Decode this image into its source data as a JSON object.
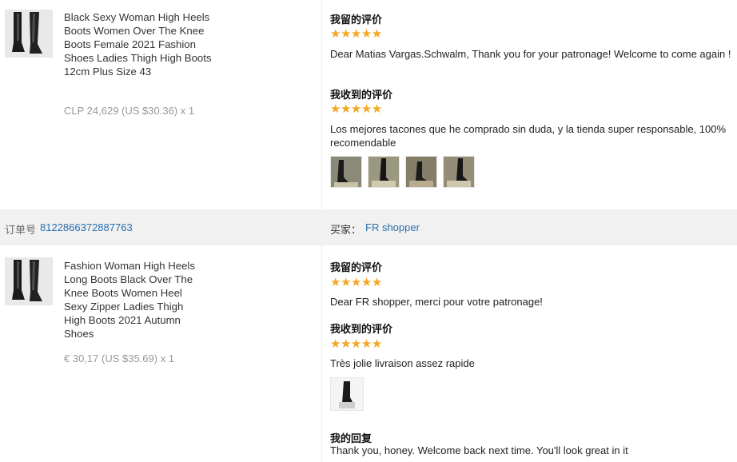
{
  "orders": [
    {
      "product": {
        "title": "Black Sexy Woman High Heels Boots Women Over The Knee Boots Female 2021 Fashion Shoes Ladies Thigh High Boots 12cm Plus Size 43",
        "price": "CLP 24,629 (US $30.36) x 1"
      },
      "my_review": {
        "label": "我留的评价",
        "stars": "★★★★★",
        "rating": 5,
        "text": "Dear Matias Vargas.Schwalm, Thank you for your patronage! Welcome to come again !"
      },
      "received_review": {
        "label": "我收到的评价",
        "stars": "★★★★★",
        "rating": 5,
        "text": "Los mejores tacones que he comprado sin duda, y la tienda super responsable, 100% recomendable",
        "photo_count": 4
      }
    },
    {
      "order_no_label": "订单号",
      "order_no": "8122866372887763",
      "buyer_label": "买家：",
      "buyer": "FR shopper",
      "product": {
        "title": "Fashion Woman High Heels Long Boots Black Over The Knee Boots Women Heel Sexy Zipper Ladies Thigh High Boots 2021 Autumn Shoes",
        "price": "€ 30,17 (US $35.69) x 1"
      },
      "my_review": {
        "label": "我留的评价",
        "stars": "★★★★★",
        "rating": 5,
        "text": "Dear FR shopper, merci pour votre patronage!"
      },
      "received_review": {
        "label": "我收到的评价",
        "stars": "★★★★★",
        "rating": 5,
        "text": "Très jolie livraison assez rapide",
        "photo_count": 1
      },
      "reply": {
        "label": "我的回复",
        "text": "Thank you, honey. Welcome back next time. You'll look great in it"
      }
    }
  ]
}
